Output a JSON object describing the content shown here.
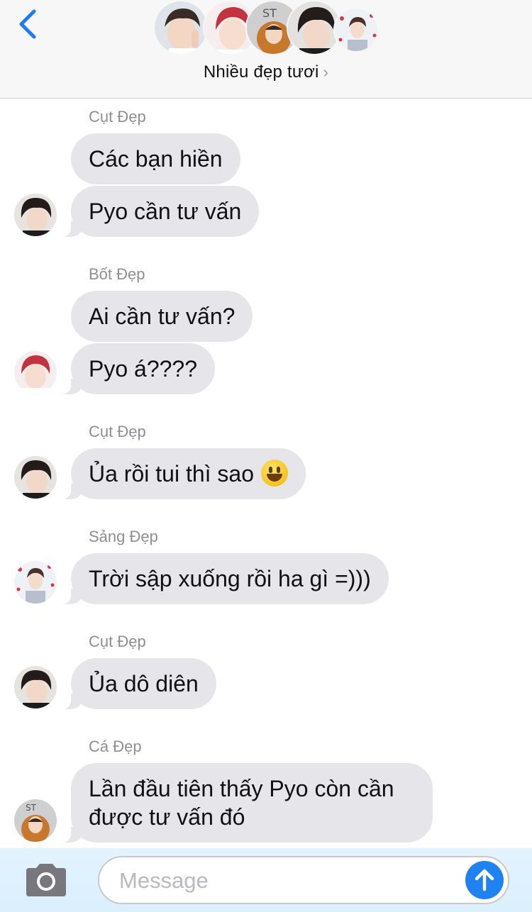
{
  "header": {
    "group_name": "Nhiều đẹp tươi",
    "chevron": "›",
    "accent": "#1e7cf2"
  },
  "messages": [
    {
      "sender": "Cụt Đẹp",
      "bubbles": [
        "Các bạn hiền",
        "Pyo cần tư vấn"
      ]
    },
    {
      "sender": "Bốt Đẹp",
      "bubbles": [
        "Ai cần tư vấn?",
        "Pyo á????"
      ]
    },
    {
      "sender": "Cụt Đẹp",
      "bubbles": [
        "Ủa rồi tui thì sao"
      ],
      "emoji": "grinning-face-icon"
    },
    {
      "sender": "Sảng Đẹp",
      "bubbles": [
        "Trời sập xuống rồi ha gì =)))"
      ]
    },
    {
      "sender": "Cụt Đẹp",
      "bubbles": [
        "Ủa dô diên"
      ]
    },
    {
      "sender": "Cá Đẹp",
      "bubbles": [
        "Lần đầu tiên thấy Pyo còn cần được tư vấn đó"
      ]
    }
  ],
  "composer": {
    "placeholder": "Message",
    "camera_icon": "camera-icon",
    "send_icon": "arrow-up-icon",
    "send_color": "#1e82f0"
  }
}
